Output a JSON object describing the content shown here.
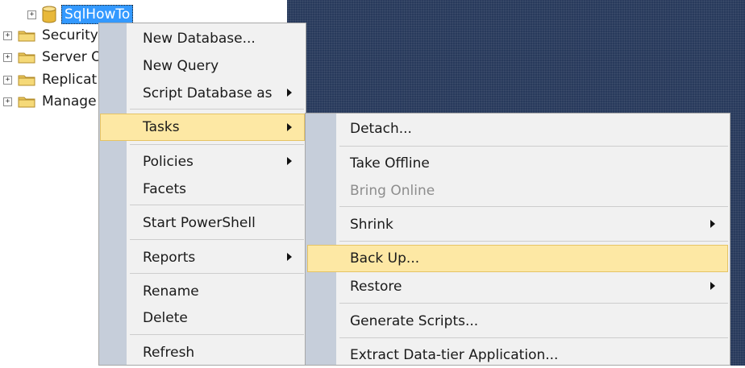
{
  "tree": {
    "selected_node": "SqlHowTo",
    "items": [
      {
        "label": "Security"
      },
      {
        "label": "Server O"
      },
      {
        "label": "Replicat"
      },
      {
        "label": "Manage"
      }
    ]
  },
  "context_menu": {
    "items": [
      {
        "label": "New Database..."
      },
      {
        "label": "New Query"
      },
      {
        "label": "Script Database as"
      },
      {
        "label": "Tasks"
      },
      {
        "label": "Policies"
      },
      {
        "label": "Facets"
      },
      {
        "label": "Start PowerShell"
      },
      {
        "label": "Reports"
      },
      {
        "label": "Rename"
      },
      {
        "label": "Delete"
      },
      {
        "label": "Refresh"
      }
    ]
  },
  "tasks_submenu": {
    "items": [
      {
        "label": "Detach..."
      },
      {
        "label": "Take Offline"
      },
      {
        "label": "Bring Online"
      },
      {
        "label": "Shrink"
      },
      {
        "label": "Back Up..."
      },
      {
        "label": "Restore"
      },
      {
        "label": "Generate Scripts..."
      },
      {
        "label": "Extract Data-tier Application..."
      }
    ]
  }
}
